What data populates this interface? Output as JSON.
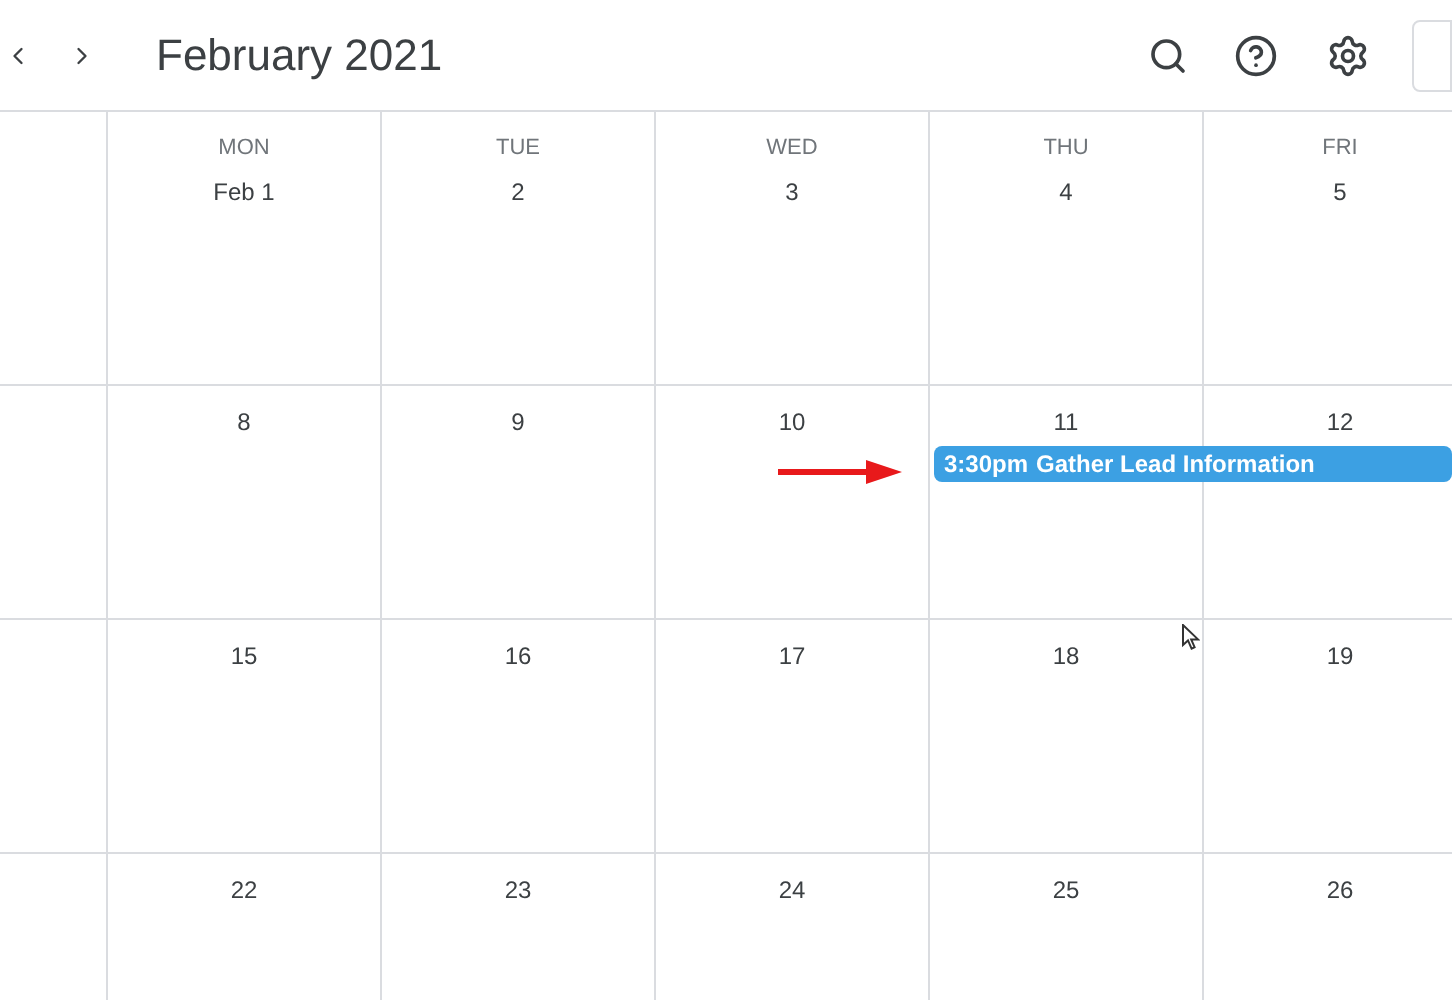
{
  "header": {
    "title": "February 2021"
  },
  "weekdays": [
    "MON",
    "TUE",
    "WED",
    "THU",
    "FRI"
  ],
  "weeks": [
    {
      "days": [
        {
          "label": "Feb 1"
        },
        {
          "label": "2"
        },
        {
          "label": "3"
        },
        {
          "label": "4"
        },
        {
          "label": "5"
        }
      ]
    },
    {
      "days": [
        {
          "label": "8"
        },
        {
          "label": "9"
        },
        {
          "label": "10"
        },
        {
          "label": "11",
          "event": {
            "time": "3:30pm",
            "title": "Gather Lead Information",
            "color": "#3ca0e3"
          }
        },
        {
          "label": "12"
        }
      ]
    },
    {
      "days": [
        {
          "label": "15"
        },
        {
          "label": "16"
        },
        {
          "label": "17"
        },
        {
          "label": "18"
        },
        {
          "label": "19"
        }
      ]
    },
    {
      "days": [
        {
          "label": "22"
        },
        {
          "label": "23"
        },
        {
          "label": "24"
        },
        {
          "label": "25"
        },
        {
          "label": "26"
        }
      ]
    }
  ]
}
